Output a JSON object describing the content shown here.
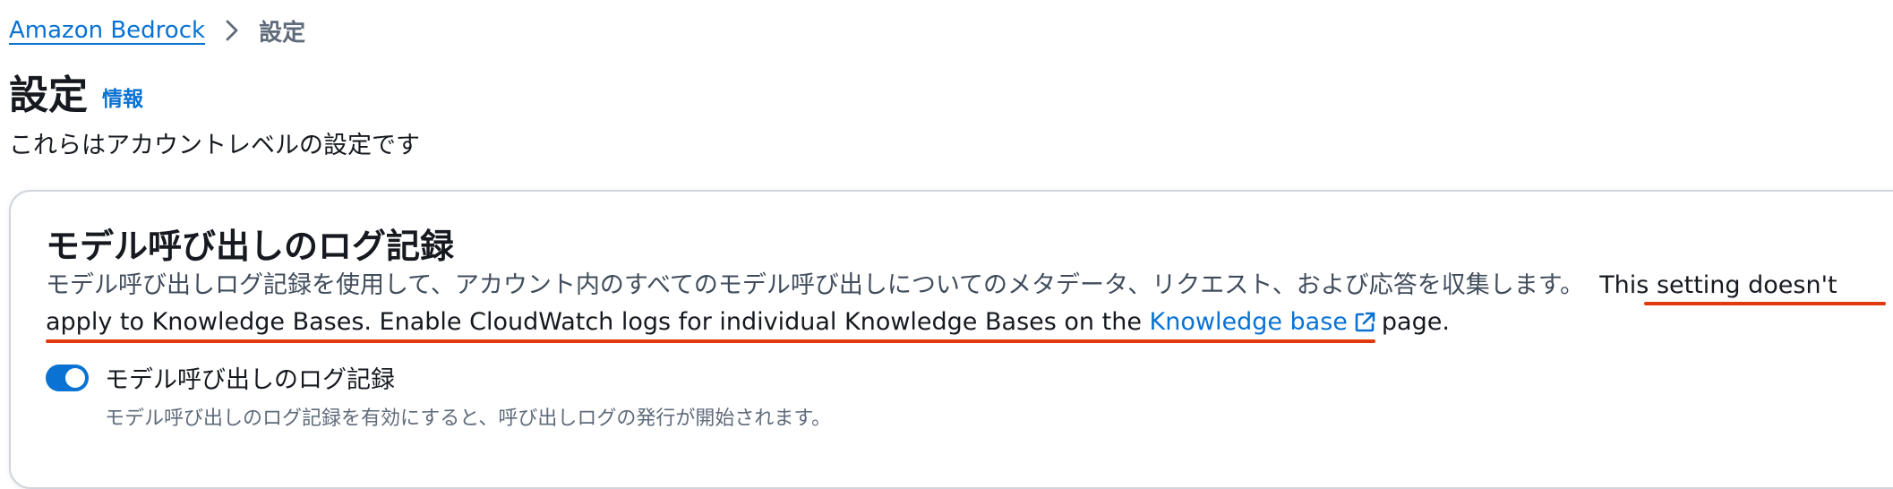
{
  "breadcrumb": {
    "items": [
      "Amazon Bedrock",
      "設定"
    ]
  },
  "header": {
    "title": "設定",
    "info_link": "情報",
    "description": "これらはアカウントレベルの設定です"
  },
  "section": {
    "title": "モデル呼び出しのログ記録",
    "description": "モデル呼び出しログ記録を使用して、アカウント内のすべてのモデル呼び出しについてのメタデータ、リクエスト、および応答を収集します。",
    "note_part1": "This setting doesn't",
    "note_part2": "apply to Knowledge Bases. Enable CloudWatch logs for individual Knowledge Bases on the",
    "note_link": "Knowledge base",
    "note_suffix": "page."
  },
  "toggle": {
    "label": "モデル呼び出しのログ記録",
    "description": "モデル呼び出しのログ記録を有効にすると、呼び出しログの発行が開始されます。",
    "enabled": true
  },
  "colors": {
    "link": "#0972d3",
    "highlight_underline": "#e1380d",
    "toggle_on": "#0972d3"
  },
  "icons": {
    "breadcrumb_separator": "chevron-right-icon",
    "external_link": "external-link-icon"
  }
}
